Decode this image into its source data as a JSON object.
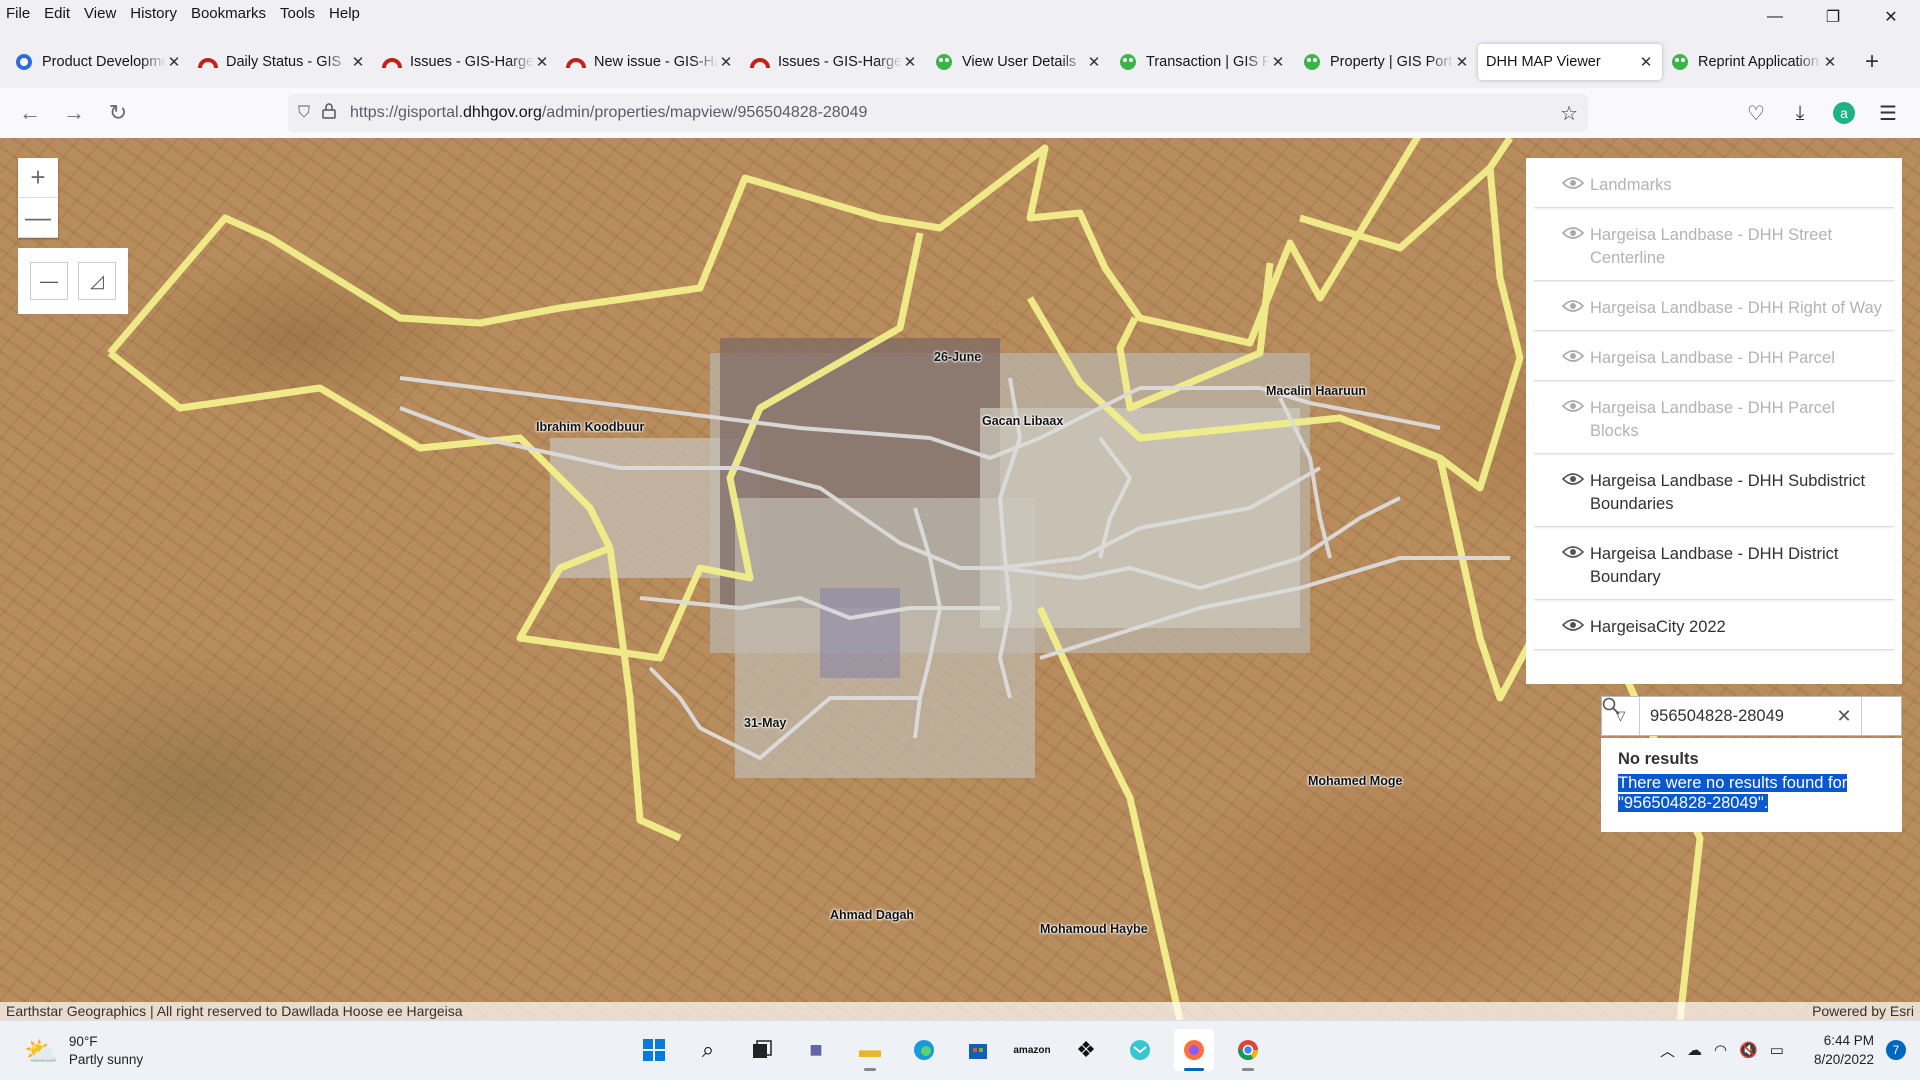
{
  "menu": [
    "File",
    "Edit",
    "View",
    "History",
    "Bookmarks",
    "Tools",
    "Help"
  ],
  "window_controls": {
    "minimize": "—",
    "restore": "❐",
    "close": "✕"
  },
  "tabs": [
    {
      "label": "Product Development",
      "icon": "blue-circle-icon"
    },
    {
      "label": "Daily Status - GIS",
      "icon": "redmine-icon"
    },
    {
      "label": "Issues - GIS-Hargeisa",
      "icon": "redmine-icon"
    },
    {
      "label": "New issue - GIS-Hargeisa",
      "icon": "redmine-icon"
    },
    {
      "label": "Issues - GIS-Hargeisa",
      "icon": "redmine-icon"
    },
    {
      "label": "View User Details",
      "icon": "green-globe-icon"
    },
    {
      "label": "Transaction | GIS Portal",
      "icon": "green-globe-icon"
    },
    {
      "label": "Property | GIS Portal",
      "icon": "green-globe-icon"
    },
    {
      "label": "DHH MAP Viewer",
      "icon": "none",
      "active": true
    },
    {
      "label": "Reprint Application",
      "icon": "green-globe-icon"
    }
  ],
  "url": {
    "prefix": "https://gisportal.",
    "host": "dhhgov.org",
    "path": "/admin/properties/mapview/956504828-28049"
  },
  "map": {
    "places": [
      {
        "name": "26-June"
      },
      {
        "name": "Ibrahim Koodbuur"
      },
      {
        "name": "Gacan Libaax"
      },
      {
        "name": "Macalin Haaruun"
      },
      {
        "name": "31-May"
      },
      {
        "name": "Mohamed Moge"
      },
      {
        "name": "Ahmad Dagah"
      },
      {
        "name": "Mohamoud Haybe"
      }
    ],
    "zoom": {
      "in": "+",
      "out": "—"
    }
  },
  "layers": [
    {
      "label": "Landmarks",
      "visible": false
    },
    {
      "label": "Hargeisa Landbase - DHH Street Centerline",
      "visible": false
    },
    {
      "label": "Hargeisa Landbase - DHH Right of Way",
      "visible": false
    },
    {
      "label": "Hargeisa Landbase - DHH Parcel",
      "visible": false
    },
    {
      "label": "Hargeisa Landbase - DHH Parcel Blocks",
      "visible": false
    },
    {
      "label": "Hargeisa Landbase - DHH Subdistrict Boundaries",
      "visible": true
    },
    {
      "label": "Hargeisa Landbase - DHH District Boundary",
      "visible": true
    },
    {
      "label": "HargeisaCity 2022",
      "visible": true
    }
  ],
  "search": {
    "value": "956504828-28049",
    "no_results_title": "No results",
    "no_results_msg": "There were no results found for \"956504828-28049\"."
  },
  "attribution": {
    "left": "Earthstar Geographics | All right reserved to Dawllada Hoose ee Hargeisa",
    "right": "Powered by Esri"
  },
  "taskbar": {
    "weather_temp": "90°F",
    "weather_desc": "Partly sunny",
    "time": "6:44 PM",
    "date": "8/20/2022",
    "notifications": "7"
  }
}
